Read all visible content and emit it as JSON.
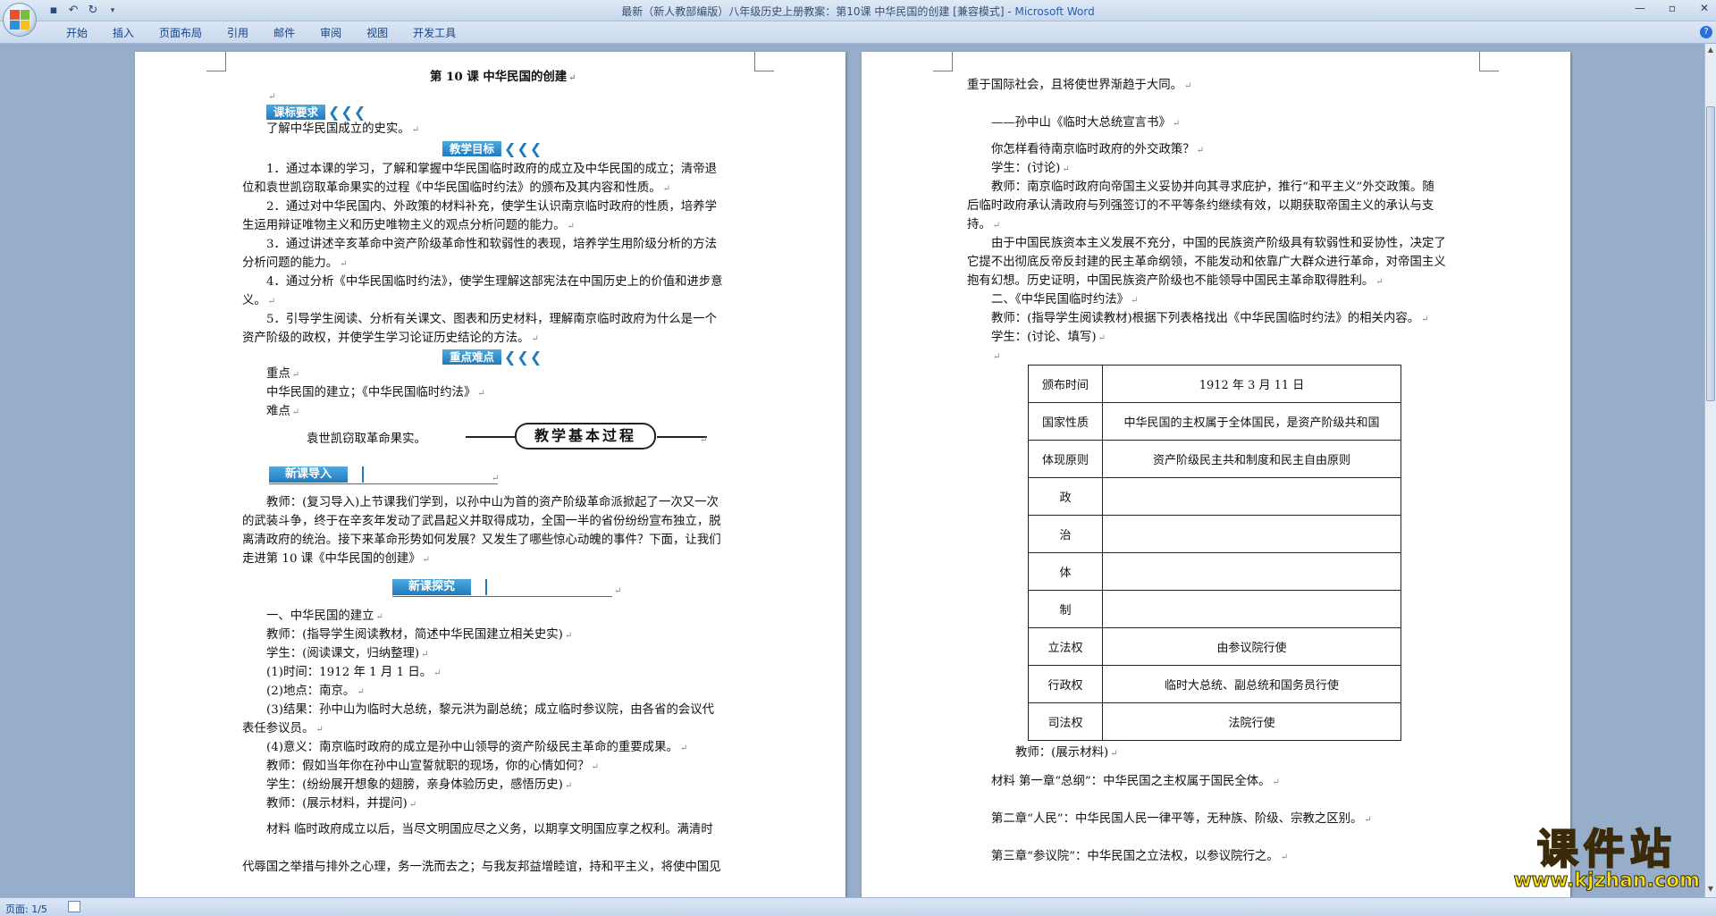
{
  "window": {
    "title": "最新（新人教部编版）八年级历史上册教案：第10课   中华民国的创建 [兼容模式] - ",
    "app": "Microsoft Word",
    "controls": [
      "—",
      "▫",
      "✕"
    ]
  },
  "ribbon": {
    "tabs": [
      "开始",
      "插入",
      "页面布局",
      "引用",
      "邮件",
      "审阅",
      "视图",
      "开发工具"
    ]
  },
  "status": {
    "page": "页面: 1/5"
  },
  "page1": {
    "title": "第 10 课   中华民国的创建",
    "banner1": "课标要求",
    "line_req": "了解中华民国成立的史实。",
    "banner2": "教学目标",
    "obj1a": "1．通过本课的学习，了解和掌握中华民国临时政府的成立及中华民国的成立；清帝退",
    "obj1b": "位和袁世凯窃取革命果实的过程《中华民国临时约法》的颁布及其内容和性质。",
    "obj2a": "2．通过对中华民国内、外政策的材料补充，使学生认识南京临时政府的性质，培养学",
    "obj2b": "生运用辩证唯物主义和历史唯物主义的观点分析问题的能力。",
    "obj3a": "3．通过讲述辛亥革命中资产阶级革命性和软弱性的表现，培养学生用阶级分析的方法",
    "obj3b": "分析问题的能力。",
    "obj4a": "4．通过分析《中华民国临时约法》，使学生理解这部宪法在中国历史上的价值和进步意",
    "obj4b": "义。",
    "obj5a": "5．引导学生阅读、分析有关课文、图表和历史材料，理解南京临时政府为什么是一个",
    "obj5b": "资产阶级的政权，并使学生学习论证历史结论的方法。",
    "banner3": "重点难点",
    "key_label": "重点",
    "key_text": "中华民国的建立；《中华民国临时约法》",
    "diff_label": "难点",
    "diff_text": "袁世凯窃取革命果实。",
    "process_title": "教学基本过程",
    "bar1": "新课导入",
    "intro_a": "教师：(复习导入)上节课我们学到，以孙中山为首的资产阶级革命派掀起了一次又一次",
    "intro_b": "的武装斗争，终于在辛亥年发动了武昌起义并取得成功，全国一半的省份纷纷宣布独立，脱",
    "intro_c": "离清政府的统治。接下来革命形势如何发展？又发生了哪些惊心动魄的事件？下面，让我们",
    "intro_d": "走进第 10 课《中华民国的创建》",
    "bar2": "新课探究",
    "s1": "一、中华民国的建立",
    "s2": "教师：(指导学生阅读教材，简述中华民国建立相关史实)",
    "s3": "学生：(阅读课文，归纳整理)",
    "s4": "(1)时间：1912 年 1 月 1 日。",
    "s5": "(2)地点：南京。",
    "s6a": "(3)结果：孙中山为临时大总统，黎元洪为副总统；成立临时参议院，由各省的会议代",
    "s6b": "表任参议员。",
    "s7": "(4)意义：南京临时政府的成立是孙中山领导的资产阶级民主革命的重要成果。",
    "s8": "教师：假如当年你在孙中山宣誓就职的现场，你的心情如何？",
    "s9": "学生：(纷纷展开想象的翅膀，亲身体验历史，感悟历史)",
    "s10": "教师：(展示材料，并提问)",
    "m1": "材料    临时政府成立以后，当尽文明国应尽之义务，以期享文明国应享之权利。满清时",
    "m2": "代辱国之举措与排外之心理，务一洗而去之；与我友邦益增睦谊，持和平主义，将使中国见"
  },
  "page2": {
    "l1": "重于国际社会，且将使世界渐趋于大同。",
    "l2": "——孙中山《临时大总统宣言书》",
    "l3": "你怎样看待南京临时政府的外交政策？",
    "l4": "学生：(讨论)",
    "l5a": "教师：南京临时政府向帝国主义妥协并向其寻求庇护，推行“和平主义”外交政策。随",
    "l5b": "后临时政府承认清政府与列强签订的不平等条约继续有效，以期获取帝国主义的承认与支",
    "l5c": "持。",
    "l6a": "由于中国民族资本主义发展不充分，中国的民族资产阶级具有软弱性和妥协性，决定了",
    "l6b": "它提不出彻底反帝反封建的民主革命纲领，不能发动和依靠广大群众进行革命，对帝国主义",
    "l6c": "抱有幻想。历史证明，中国民族资产阶级也不能领导中国民主革命取得胜利。",
    "l7": "二、《中华民国临时约法》",
    "l8": "教师：(指导学生阅读教材)根据下列表格找出《中华民国临时约法》的相关内容。",
    "l9": "学生：(讨论、填写)",
    "table": [
      {
        "k": "颁布时间",
        "v": "1912 年 3 月 11 日"
      },
      {
        "k": "国家性质",
        "v": "中华民国的主权属于全体国民，是资产阶级共和国"
      },
      {
        "k": "体现原则",
        "v": "资产阶级民主共和制度和民主自由原则"
      },
      {
        "k": "政",
        "v": ""
      },
      {
        "k": "治",
        "v": ""
      },
      {
        "k": "体",
        "v": ""
      },
      {
        "k": "制",
        "v": ""
      },
      {
        "k": "立法权",
        "v": "由参议院行使"
      },
      {
        "k": "行政权",
        "v": "临时大总统、副总统和国务员行使"
      },
      {
        "k": "司法权",
        "v": "法院行使"
      }
    ],
    "l10": "教师：(展示材料)",
    "l11": "材料    第一章“总纲”：中华民国之主权属于国民全体。",
    "l12": "第二章“人民”：中华民国人民一律平等，无种族、阶级、宗教之区别。",
    "l13": "第三章“参议院”：中华民国之立法权，以参议院行之。"
  },
  "watermark": {
    "main": "课件站",
    "url": "www.kjzhan.com"
  },
  "icons": [
    "office-button-icon",
    "save-icon",
    "undo-icon",
    "redo-icon",
    "customize-icon",
    "help-icon"
  ]
}
